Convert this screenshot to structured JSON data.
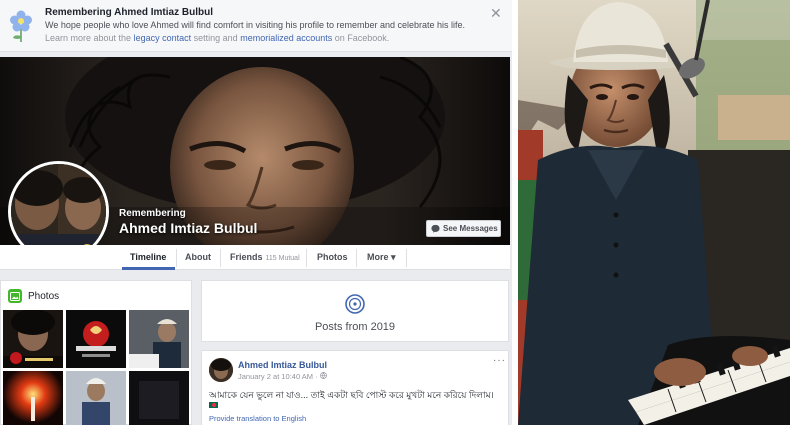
{
  "banner": {
    "title": "Remembering Ahmed Imtiaz Bulbul",
    "body": "We hope people who love Ahmed will find comfort in visiting his profile to remember and celebrate his life.",
    "learn_prefix": "Learn more about the",
    "legacy_link": "legacy contact",
    "learn_mid": "setting and",
    "memorialized_link": "memorialized accounts",
    "learn_suffix": "on Facebook.",
    "close": "✕"
  },
  "profile": {
    "remembering_label": "Remembering",
    "name": "Ahmed Imtiaz Bulbul",
    "see_messages": "See Messages"
  },
  "tabs": [
    {
      "label": "Timeline"
    },
    {
      "label": "About"
    },
    {
      "label": "Friends",
      "sub": "115 Mutual"
    },
    {
      "label": "Photos"
    },
    {
      "label": "More ▾"
    }
  ],
  "photos": {
    "title": "Photos"
  },
  "posts_from": {
    "label": "Posts from 2019"
  },
  "post": {
    "author": "Ahmed Imtiaz Bulbul",
    "date": "January 2 at 10:40 AM · ",
    "more": "···",
    "text": "আমাকে যেন ভুলে না যাও... তাই একটা ছবি পোস্ট করে মুখটা মনে করিয়ে দিলাম।",
    "translate": "Provide translation to English"
  },
  "colors": {
    "fb_blue": "#4267b2",
    "link_blue": "#385898",
    "page_bg": "#e9ebee",
    "photos_icon": "#42b72a"
  }
}
